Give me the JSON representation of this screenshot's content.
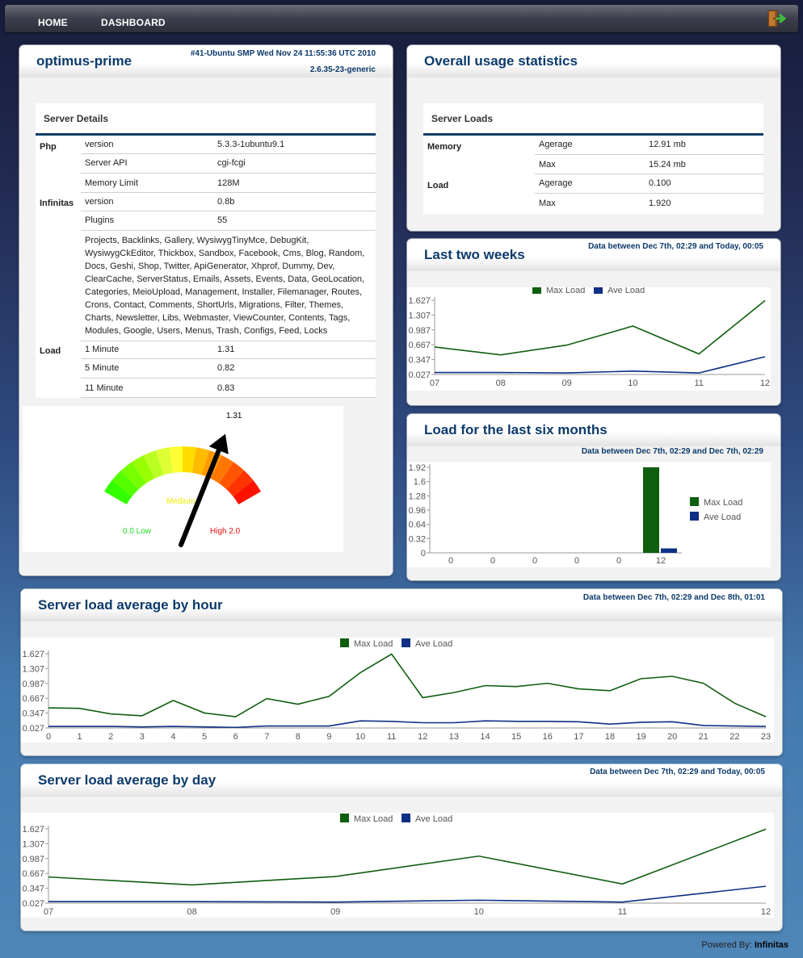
{
  "nav": {
    "home": "HOME",
    "dashboard": "DASHBOARD",
    "logout_icon": "exit-door-icon"
  },
  "server": {
    "hostname": "optimus-prime",
    "kernel_build": "#41-Ubuntu SMP Wed Nov 24 11:55:36 UTC 2010",
    "kernel_release": "2.6.35-23-generic"
  },
  "details": {
    "title": "Server Details",
    "php_label": "Php",
    "php": [
      {
        "key": "version",
        "value": "5.3.3-1ubuntu9.1"
      },
      {
        "key": "Server API",
        "value": "cgi-fcgi"
      },
      {
        "key": "Memory Limit",
        "value": "128M"
      }
    ],
    "infinitas_label": "Infinitas",
    "infinitas": [
      {
        "key": "version",
        "value": "0.8b"
      },
      {
        "key": "Plugins",
        "value": "55"
      }
    ],
    "plugin_lines": [
      "Projects, Backlinks, Gallery, WysiwygTinyMce, DebugKit,",
      "WysiwygCkEditor, Thickbox, Sandbox, Facebook, Cms, Blog, Random,",
      "Docs, Geshi, Shop, Twitter, ApiGenerator, Xhprof, Dummy, Dev,",
      "ClearCache, ServerStatus, Emails, Assets, Events, Data, GeoLocation,",
      "Categories, MeioUpload, Management, Installer, Filemanager, Routes,",
      "Crons, Contact, Comments, ShortUrls, Migrations, Filter, Themes,",
      "Charts, Newsletter, Libs, Webmaster, ViewCounter, Contents, Tags,",
      "Modules, Google, Users, Menus, Trash, Configs, Feed, Locks"
    ],
    "load_label": "Load",
    "load": [
      {
        "key": "1 Minute",
        "value": "1.31"
      },
      {
        "key": "5 Minute",
        "value": "0.82"
      },
      {
        "key": "11 Minute",
        "value": "0.83"
      }
    ]
  },
  "gauge": {
    "value_label": "1.31",
    "value": 1.31,
    "min": 0,
    "max": 2,
    "low_label": "0.0 Low",
    "medium_label": "Medium",
    "high_label": "High 2.0",
    "colors": [
      "#33ff00",
      "#55ff00",
      "#77ff00",
      "#99ff00",
      "#bbff22",
      "#ddff33",
      "#ffff33",
      "#ffdd00",
      "#ffbb00",
      "#ff9900",
      "#ff7700",
      "#ff5500",
      "#ff3300",
      "#ff1100"
    ]
  },
  "overall": {
    "title": "Overall usage statistics",
    "box_title": "Server Loads",
    "memory_label": "Memory",
    "memory": [
      {
        "key": "Agerage",
        "value": "12.91 mb"
      },
      {
        "key": "Max",
        "value": "15.24 mb"
      }
    ],
    "load_label": "Load",
    "load": [
      {
        "key": "Agerage",
        "value": "0.100"
      },
      {
        "key": "Max",
        "value": "1.920"
      }
    ]
  },
  "legend": {
    "max": "Max Load",
    "ave": "Ave Load",
    "max_color": "#0f5e0f",
    "ave_color": "#0e2f85"
  },
  "two_weeks": {
    "title": "Last two weeks",
    "range": "Data between Dec 7th, 02:29 and Today, 00:05"
  },
  "six_months": {
    "title": "Load for the last six months",
    "range": "Data between Dec 7th, 02:29 and Dec 7th, 02:29"
  },
  "by_hour": {
    "title": "Server load average by hour",
    "range": "Data between Dec 7th, 02:29 and Dec 8th, 01:01"
  },
  "by_day": {
    "title": "Server load average by day",
    "range": "Data between Dec 7th, 02:29 and Today, 00:05"
  },
  "footer": {
    "powered_by": "Powered By:",
    "brand": "Infinitas"
  },
  "chart_data": [
    {
      "type": "line",
      "id": "two_weeks",
      "categories": [
        "07",
        "08",
        "09",
        "10",
        "11",
        "12"
      ],
      "yticks": [
        "0.027",
        "0.347",
        "0.667",
        "0.987",
        "1.307",
        "1.627"
      ],
      "ylim": [
        0.027,
        1.627
      ],
      "series": [
        {
          "name": "Max Load",
          "values": [
            0.62,
            0.45,
            0.66,
            1.07,
            0.47,
            1.62
          ]
        },
        {
          "name": "Ave Load",
          "values": [
            0.07,
            0.07,
            0.06,
            0.1,
            0.06,
            0.41
          ]
        }
      ]
    },
    {
      "type": "bar",
      "id": "six_months",
      "categories": [
        "0",
        "0",
        "0",
        "0",
        "0",
        "12"
      ],
      "yticks": [
        "0",
        "0.32",
        "0.64",
        "0.96",
        "1.28",
        "1.6",
        "1.92"
      ],
      "ylim": [
        0,
        1.92
      ],
      "series": [
        {
          "name": "Max Load",
          "values": [
            0,
            0,
            0,
            0,
            0,
            1.92
          ]
        },
        {
          "name": "Ave Load",
          "values": [
            0,
            0,
            0,
            0,
            0,
            0.1
          ]
        }
      ]
    },
    {
      "type": "line",
      "id": "by_hour",
      "categories": [
        "0",
        "1",
        "2",
        "3",
        "4",
        "5",
        "6",
        "7",
        "8",
        "9",
        "10",
        "11",
        "12",
        "13",
        "14",
        "15",
        "16",
        "17",
        "18",
        "19",
        "20",
        "21",
        "22",
        "23"
      ],
      "yticks": [
        "0.027",
        "0.347",
        "0.667",
        "0.987",
        "1.307",
        "1.627"
      ],
      "ylim": [
        0.027,
        1.627
      ],
      "series": [
        {
          "name": "Max Load",
          "values": [
            0.46,
            0.45,
            0.33,
            0.29,
            0.62,
            0.35,
            0.27,
            0.66,
            0.54,
            0.71,
            1.22,
            1.62,
            0.68,
            0.79,
            0.94,
            0.92,
            0.99,
            0.87,
            0.83,
            1.09,
            1.14,
            0.99,
            0.56,
            0.27
          ]
        },
        {
          "name": "Ave Load",
          "values": [
            0.06,
            0.06,
            0.06,
            0.05,
            0.06,
            0.05,
            0.04,
            0.07,
            0.07,
            0.07,
            0.18,
            0.17,
            0.14,
            0.14,
            0.18,
            0.17,
            0.17,
            0.16,
            0.11,
            0.15,
            0.16,
            0.08,
            0.07,
            0.06
          ]
        }
      ]
    },
    {
      "type": "line",
      "id": "by_day",
      "categories": [
        "07",
        "08",
        "09",
        "10",
        "11",
        "12"
      ],
      "yticks": [
        "0.027",
        "0.347",
        "0.667",
        "0.987",
        "1.307",
        "1.627"
      ],
      "ylim": [
        0.027,
        1.627
      ],
      "series": [
        {
          "name": "Max Load",
          "values": [
            0.59,
            0.42,
            0.6,
            1.04,
            0.44,
            1.62
          ]
        },
        {
          "name": "Ave Load",
          "values": [
            0.06,
            0.06,
            0.05,
            0.09,
            0.05,
            0.39
          ]
        }
      ]
    }
  ]
}
